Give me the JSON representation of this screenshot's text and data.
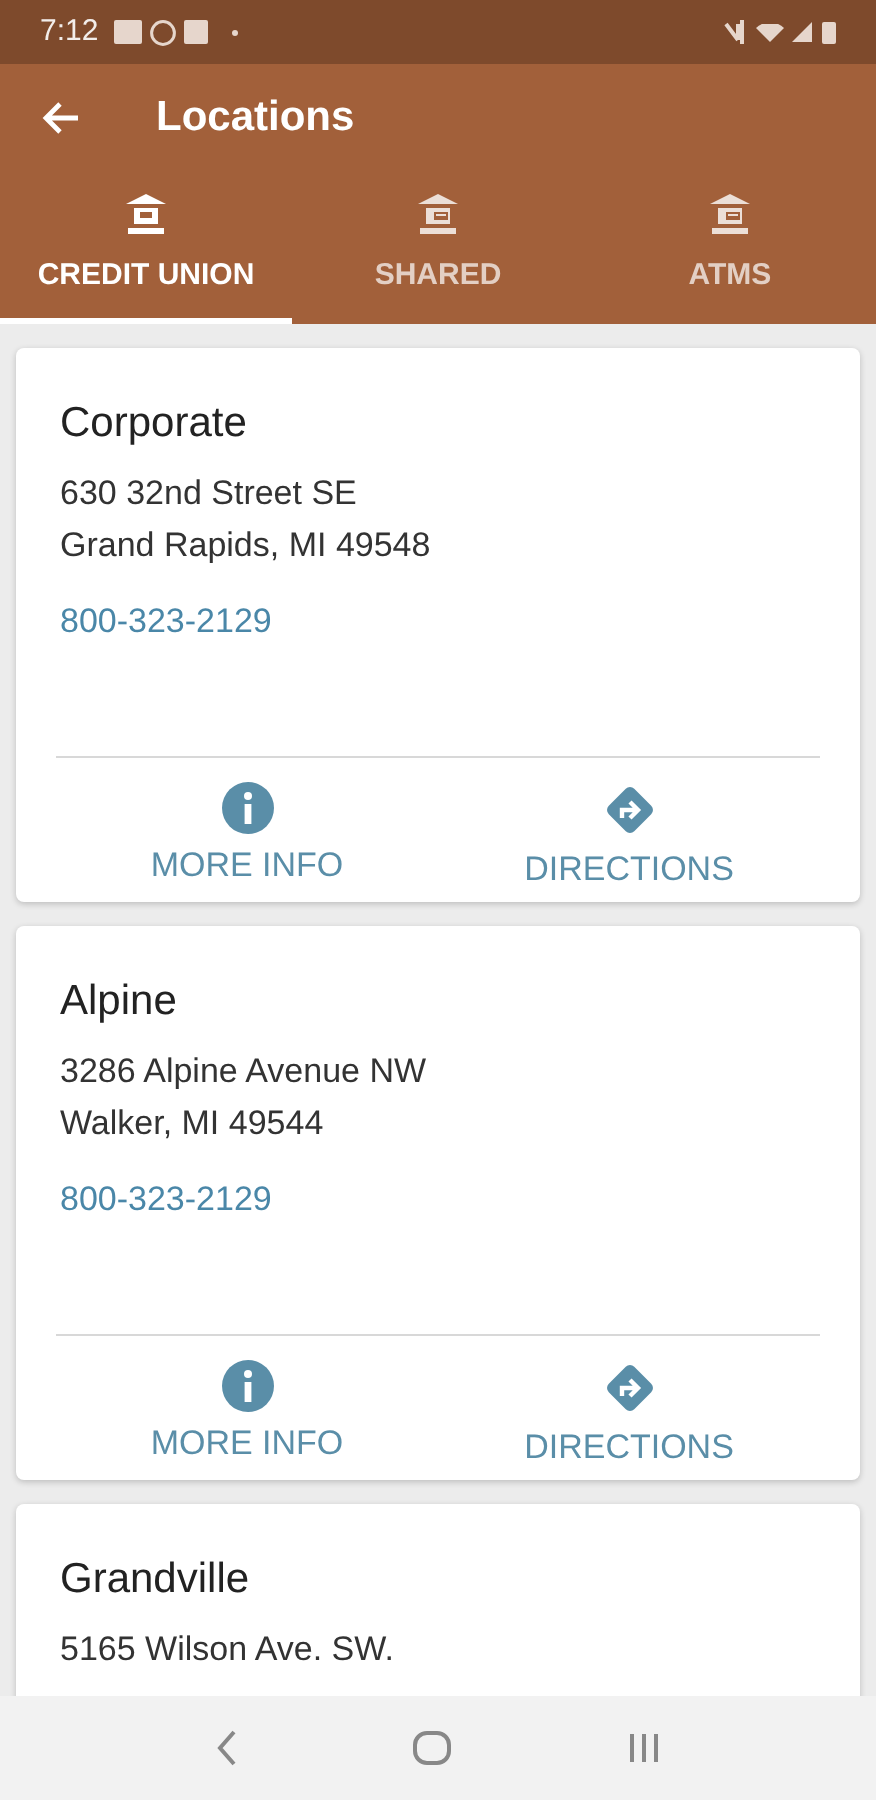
{
  "status_bar": {
    "time": "7:12"
  },
  "app_bar": {
    "title": "Locations"
  },
  "tabs": [
    {
      "label": "CREDIT UNION",
      "selected": true,
      "kind": "cu"
    },
    {
      "label": "SHARED",
      "selected": false,
      "kind": "shared"
    },
    {
      "label": "ATMS",
      "selected": false,
      "kind": "atm"
    }
  ],
  "locations": [
    {
      "name": "Corporate",
      "address": [
        "630 32nd Street SE",
        "Grand Rapids, MI 49548"
      ],
      "phone": "800-323-2129",
      "actions": [
        "MORE INFO",
        "DIRECTIONS"
      ]
    },
    {
      "name": "Alpine",
      "address": [
        "3286 Alpine Avenue NW",
        "Walker, MI 49544"
      ],
      "phone": "800-323-2129",
      "actions": [
        "MORE INFO",
        "DIRECTIONS"
      ]
    },
    {
      "name": "Grandville",
      "address": [
        "5165 Wilson Ave. SW."
      ]
    }
  ]
}
